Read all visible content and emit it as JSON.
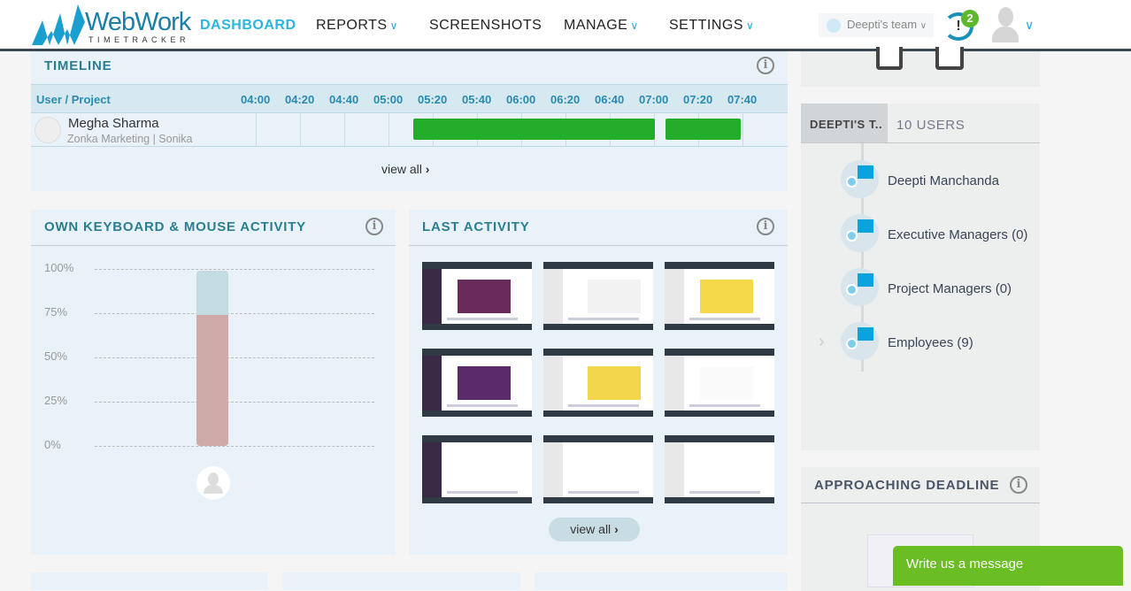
{
  "header": {
    "logo_title": "WebWork",
    "logo_sub": "TIMETRACKER",
    "nav": [
      {
        "label": "DASHBOARD",
        "active": true
      },
      {
        "label": "REPORTS",
        "dropdown": true
      },
      {
        "label": "SCREENSHOTS"
      },
      {
        "label": "MANAGE",
        "dropdown": true
      },
      {
        "label": "SETTINGS",
        "dropdown": true
      }
    ],
    "team": "Deepti's team",
    "notifications": "2"
  },
  "timeline": {
    "title": "TIMELINE",
    "col_user": "User / Project",
    "ticks": [
      "04:00",
      "04:20",
      "04:40",
      "05:00",
      "05:20",
      "05:40",
      "06:00",
      "06:20",
      "06:40",
      "07:00",
      "07:20",
      "07:40"
    ],
    "rows": [
      {
        "name": "Megha Sharma",
        "project": "Zonka Marketing | Sonika",
        "activity": [
          [
            "05:11",
            "06:56"
          ],
          [
            "07:01",
            "07:35"
          ]
        ]
      }
    ],
    "view_all": "view all"
  },
  "keyboard": {
    "title": "OWN KEYBOARD & MOUSE ACTIVITY"
  },
  "chart_data": {
    "type": "bar",
    "categories": [
      "Megha Sharma"
    ],
    "values": [
      75
    ],
    "ylim": [
      0,
      100
    ],
    "yticks": [
      "100%",
      "75%",
      "50%",
      "25%",
      "0%"
    ],
    "grid": true,
    "colors": {
      "value": "#cfaaa8",
      "remainder": "#c3dce1"
    }
  },
  "last_activity": {
    "title": "LAST ACTIVITY",
    "view_all": "view all",
    "screenshot_count": 9
  },
  "team_panel": {
    "tab_team": "DEEPTI'S T..",
    "tab_users": "10 USERS",
    "nodes": [
      {
        "label": "Deepti Manchanda",
        "icon": "home-user-icon"
      },
      {
        "label": "Executive Managers (0)",
        "icon": "chart-user-icon"
      },
      {
        "label": "Project Managers (0)",
        "icon": "chart-user-icon"
      },
      {
        "label": "Employees (9)",
        "icon": "laptop-user-icon"
      }
    ]
  },
  "deadline": {
    "title": "APPROACHING DEADLINE"
  },
  "chat": {
    "label": "Write us a message"
  },
  "colors": {
    "accent": "#29b6e0",
    "bar": "#22ad2a",
    "chat": "#6abd23"
  }
}
